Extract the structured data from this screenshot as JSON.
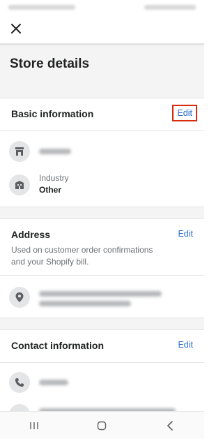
{
  "topbar": {
    "close_icon": "close-icon"
  },
  "title": "Store details",
  "basic": {
    "title": "Basic information",
    "edit_label": "Edit",
    "store_icon": "store-icon",
    "industry_icon": "building-icon",
    "industry_label": "Industry",
    "industry_value": "Other"
  },
  "address": {
    "title": "Address",
    "edit_label": "Edit",
    "description": "Used on customer order confirmations and your Shopify bill.",
    "pin_icon": "location-pin-icon"
  },
  "contact": {
    "title": "Contact information",
    "edit_label": "Edit",
    "phone_icon": "phone-icon",
    "email_icon": "mail-icon"
  },
  "colors": {
    "accent": "#2c6ecb",
    "highlight": "#d72c0d",
    "background": "#f4f4f4"
  },
  "navbar": {
    "recents_icon": "recent-apps-icon",
    "home_icon": "home-icon",
    "back_icon": "back-icon"
  }
}
